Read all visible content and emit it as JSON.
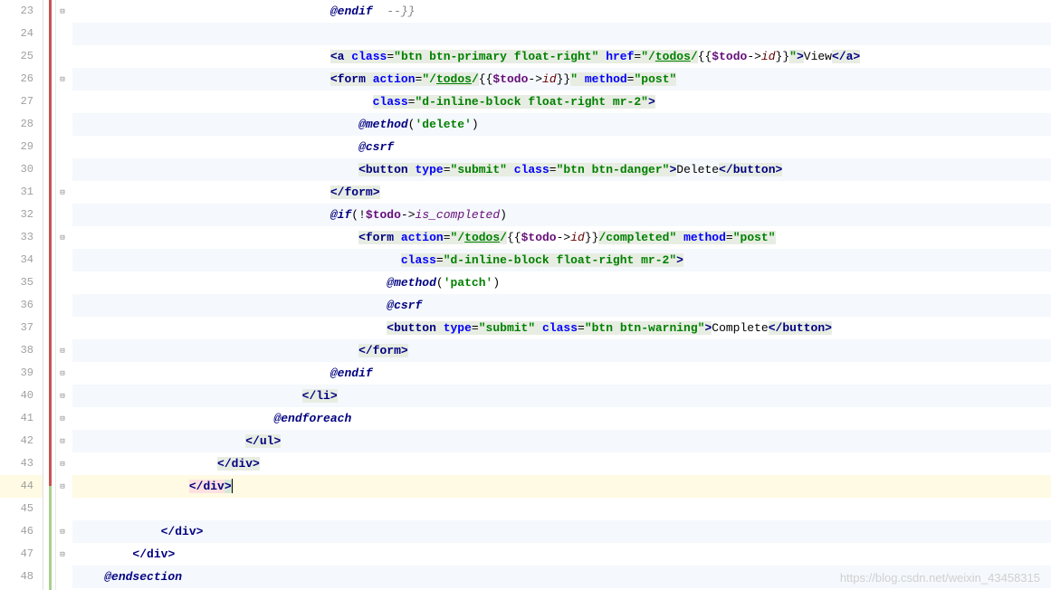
{
  "line_numbers": [
    "23",
    "24",
    "25",
    "26",
    "27",
    "28",
    "29",
    "30",
    "31",
    "32",
    "33",
    "34",
    "35",
    "36",
    "37",
    "38",
    "39",
    "40",
    "41",
    "42",
    "43",
    "44",
    "45",
    "46",
    "47",
    "48"
  ],
  "current_line_index": 21,
  "watermark": "https://blog.csdn.net/weixin_43458315",
  "code": {
    "l23": {
      "indent": "                                    ",
      "t0": "@endif",
      "t1": "  --}}"
    },
    "l25": {
      "indent": "                                    ",
      "lt": "<",
      "tag": "a",
      "sp1": " ",
      "a1": "class",
      "eq1": "=",
      "q1a": "\"",
      "v1": "btn btn-primary float-right",
      "q1b": "\"",
      "sp2": " ",
      "a2": "href",
      "eq2": "=",
      "q2a": "\"",
      "v2a": "/",
      "v2b": "todos",
      "v2c": "/",
      "dl1": "{{",
      "var": "$todo",
      "arr": "->",
      "prop": "id",
      "dl2": "}}",
      "q2b": "\"",
      "gt": ">",
      "txt": "View",
      "ct": "</",
      "ctag": "a",
      "cgt": ">"
    },
    "l26": {
      "indent": "                                    ",
      "lt": "<",
      "tag": "form",
      "sp1": " ",
      "a1": "action",
      "eq1": "=",
      "q1a": "\"",
      "v1a": "/",
      "v1b": "todos",
      "v1c": "/",
      "dl1": "{{",
      "var": "$todo",
      "arr": "->",
      "prop": "id",
      "dl2": "}}",
      "q1b": "\"",
      "sp2": " ",
      "a2": "method",
      "eq2": "=",
      "q2a": "\"",
      "v2": "post",
      "q2b": "\""
    },
    "l27": {
      "indent": "                                          ",
      "a1": "class",
      "eq1": "=",
      "q1a": "\"",
      "v1": "d-inline-block float-right mr-2",
      "q1b": "\"",
      "gt": ">"
    },
    "l28": {
      "indent": "                                        ",
      "dir": "@method",
      "p1": "(",
      "q1": "'",
      "v": "delete",
      "q2": "'",
      "p2": ")"
    },
    "l29": {
      "indent": "                                        ",
      "dir": "@csrf"
    },
    "l30": {
      "indent": "                                        ",
      "lt": "<",
      "tag": "button",
      "sp1": " ",
      "a1": "type",
      "eq1": "=",
      "q1a": "\"",
      "v1": "submit",
      "q1b": "\"",
      "sp2": " ",
      "a2": "class",
      "eq2": "=",
      "q2a": "\"",
      "v2": "btn btn-danger",
      "q2b": "\"",
      "gt": ">",
      "txt": "Delete",
      "ct": "</",
      "ctag": "button",
      "cgt": ">"
    },
    "l31": {
      "indent": "                                    ",
      "ct": "</",
      "tag": "form",
      "gt": ">"
    },
    "l32": {
      "indent": "                                    ",
      "dir": "@if",
      "p1": "(",
      "neg": "!",
      "var": "$todo",
      "arr": "->",
      "prop": "is_completed",
      "p2": ")"
    },
    "l33": {
      "indent": "                                        ",
      "lt": "<",
      "tag": "form",
      "sp1": " ",
      "a1": "action",
      "eq1": "=",
      "q1a": "\"",
      "v1a": "/",
      "v1b": "todos",
      "v1c": "/",
      "dl1": "{{",
      "var": "$todo",
      "arr": "->",
      "prop": "id",
      "dl2": "}}",
      "v1d": "/completed",
      "q1b": "\"",
      "sp2": " ",
      "a2": "method",
      "eq2": "=",
      "q2a": "\"",
      "v2": "post",
      "q2b": "\""
    },
    "l34": {
      "indent": "                                              ",
      "a1": "class",
      "eq1": "=",
      "q1a": "\"",
      "v1": "d-inline-block float-right mr-2",
      "q1b": "\"",
      "gt": ">"
    },
    "l35": {
      "indent": "                                            ",
      "dir": "@method",
      "p1": "(",
      "q1": "'",
      "v": "patch",
      "q2": "'",
      "p2": ")"
    },
    "l36": {
      "indent": "                                            ",
      "dir": "@csrf"
    },
    "l37": {
      "indent": "                                            ",
      "lt": "<",
      "tag": "button",
      "sp1": " ",
      "a1": "type",
      "eq1": "=",
      "q1a": "\"",
      "v1": "submit",
      "q1b": "\"",
      "sp2": " ",
      "a2": "class",
      "eq2": "=",
      "q2a": "\"",
      "v2": "btn btn-warning",
      "q2b": "\"",
      "gt": ">",
      "txt": "Complete",
      "ct": "</",
      "ctag": "button",
      "cgt": ">"
    },
    "l38": {
      "indent": "                                        ",
      "ct": "</",
      "tag": "form",
      "gt": ">"
    },
    "l39": {
      "indent": "                                    ",
      "dir": "@endif"
    },
    "l40": {
      "indent": "                                ",
      "ct": "</",
      "tag": "li",
      "gt": ">"
    },
    "l41": {
      "indent": "                            ",
      "dir": "@endforeach"
    },
    "l42": {
      "indent": "                        ",
      "ct": "</",
      "tag": "ul",
      "gt": ">"
    },
    "l43": {
      "indent": "                    ",
      "ct": "</",
      "tag": "div",
      "gt": ">"
    },
    "l44": {
      "indent": "                ",
      "ct": "</",
      "tag": "div",
      "gt": ">"
    },
    "l46": {
      "indent": "            ",
      "ct": "</",
      "tag": "div",
      "gt": ">"
    },
    "l47": {
      "indent": "        ",
      "ct": "</",
      "tag": "div",
      "gt": ">"
    },
    "l48": {
      "indent": "    ",
      "dir": "@endsection"
    }
  }
}
